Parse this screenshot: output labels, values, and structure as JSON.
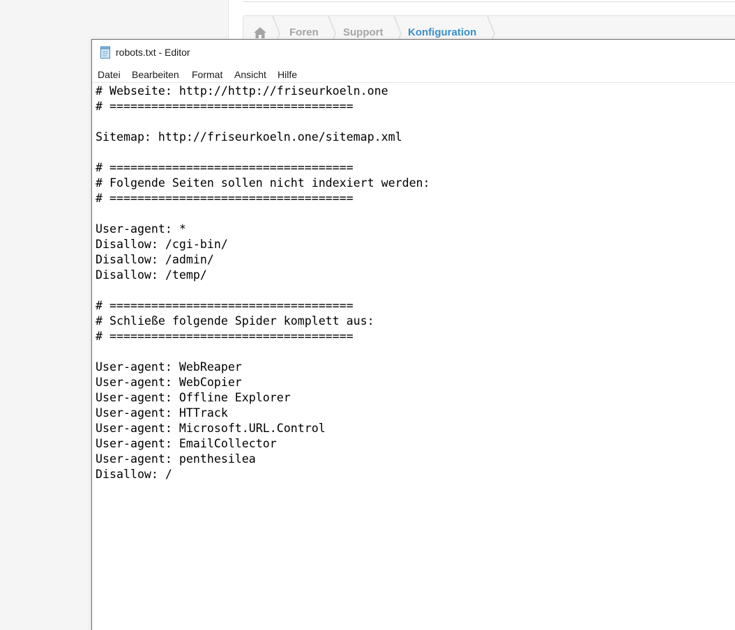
{
  "background": {
    "breadcrumb": {
      "home_icon": "home-icon",
      "items": [
        "Foren",
        "Support",
        "Konfiguration"
      ],
      "active_color": "#3a8fc9",
      "inactive_color": "#a5a5a5"
    }
  },
  "window": {
    "title": "robots.txt - Editor",
    "app_icon": "notepad-icon",
    "menu": [
      "Datei",
      "Bearbeiten",
      "Format",
      "Ansicht",
      "Hilfe"
    ],
    "content": "# Webseite: http://http://friseurkoeln.one\n# ===================================\n\nSitemap: http://friseurkoeln.one/sitemap.xml\n\n# ===================================\n# Folgende Seiten sollen nicht indexiert werden:\n# ===================================\n\nUser-agent: *\nDisallow: /cgi-bin/\nDisallow: /admin/\nDisallow: /temp/\n\n# ===================================\n# Schließe folgende Spider komplett aus:\n# ===================================\n\nUser-agent: WebReaper\nUser-agent: WebCopier\nUser-agent: Offline Explorer\nUser-agent: HTTrack\nUser-agent: Microsoft.URL.Control\nUser-agent: EmailCollector\nUser-agent: penthesilea\nDisallow: /"
  }
}
